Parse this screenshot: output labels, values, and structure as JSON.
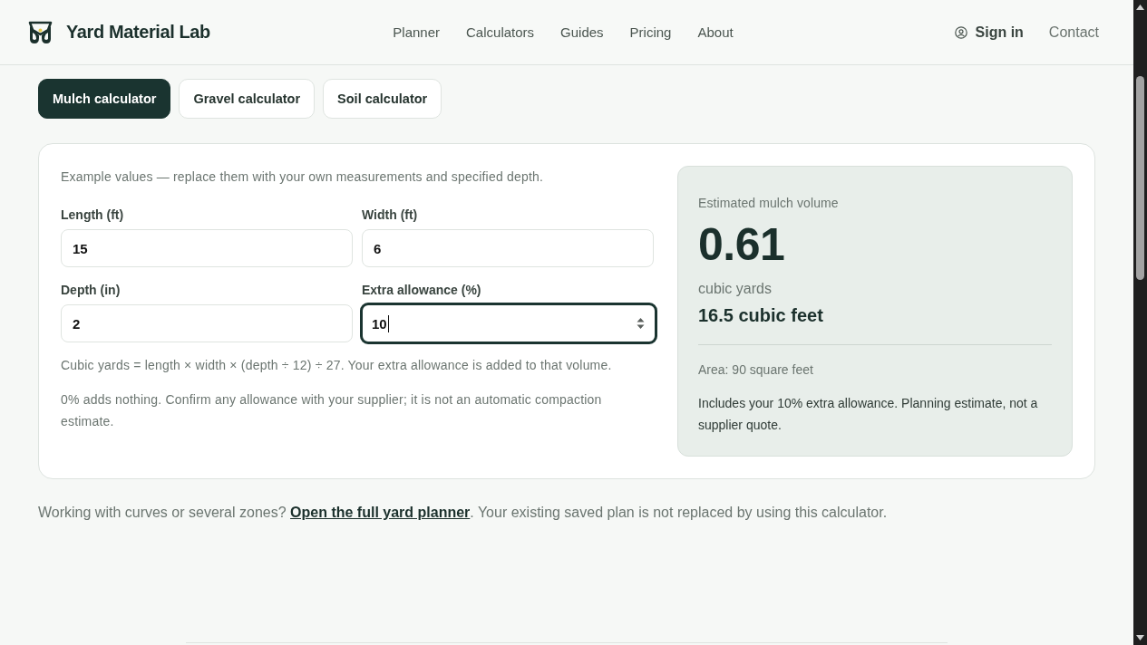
{
  "header": {
    "brand": "Yard Material Lab",
    "nav": [
      {
        "label": "Planner"
      },
      {
        "label": "Calculators"
      },
      {
        "label": "Guides"
      },
      {
        "label": "Pricing"
      },
      {
        "label": "About"
      }
    ],
    "sign_in": "Sign in",
    "contact": "Contact"
  },
  "calculator_tabs": [
    {
      "label": "Mulch calculator",
      "selected": true
    },
    {
      "label": "Gravel calculator",
      "selected": false
    },
    {
      "label": "Soil calculator",
      "selected": false
    }
  ],
  "form": {
    "intro": "Example values — replace them with your own measurements and specified depth.",
    "fields": [
      {
        "label": "Length (ft)",
        "value": "15",
        "focused": false
      },
      {
        "label": "Width (ft)",
        "value": "6",
        "focused": false
      },
      {
        "label": "Depth (in)",
        "value": "2",
        "focused": false
      },
      {
        "label": "Extra allowance (%)",
        "value": "10",
        "focused": true
      }
    ],
    "notes": [
      "Cubic yards = length × width × (depth ÷ 12) ÷ 27. Your extra allowance is added to that volume.",
      "0% adds nothing. Confirm any allowance with your supplier; it is not an automatic compaction estimate."
    ]
  },
  "result": {
    "label": "Estimated mulch volume",
    "value": "0.61",
    "unit": "cubic yards",
    "secondary": "16.5 cubic feet",
    "area": "Area: 90 square feet",
    "note": "Includes your 10% extra allowance. Planning estimate, not a supplier quote."
  },
  "footer_note": {
    "before": "Working with curves or several zones?",
    "link": "Open the full yard planner",
    "after": ". Your existing saved plan is not replaced by using this calculator."
  }
}
